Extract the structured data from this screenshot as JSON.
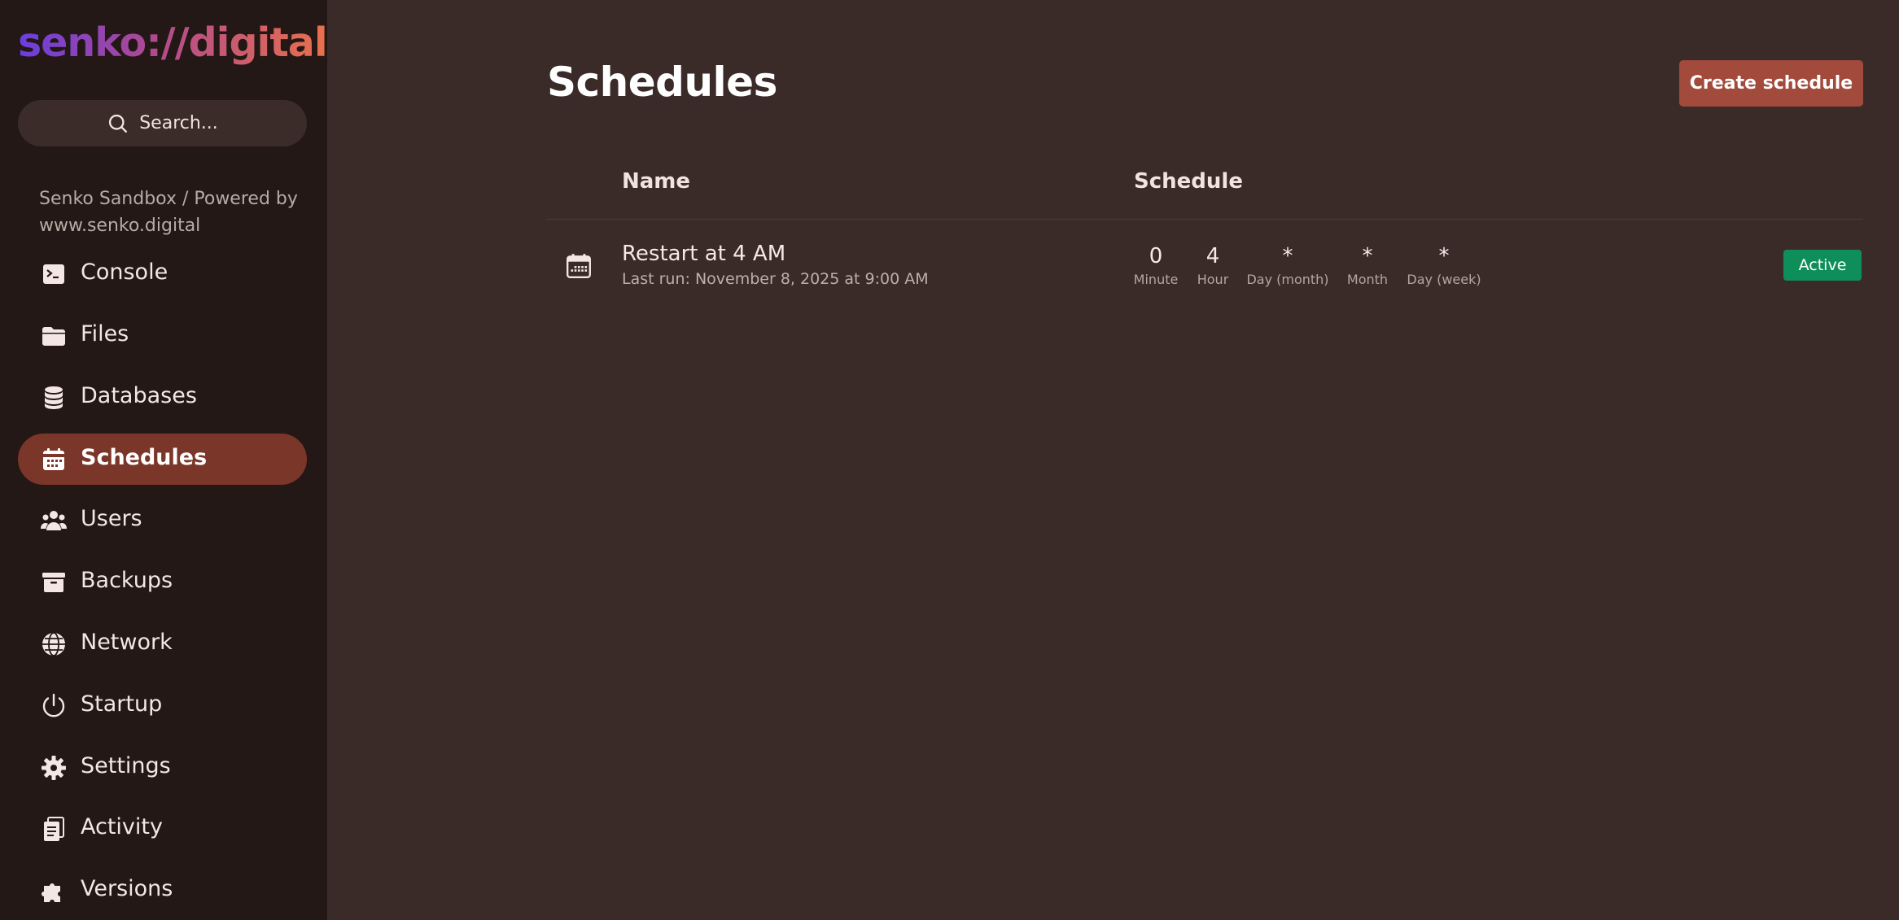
{
  "brand": {
    "logo": "senko://digital"
  },
  "search": {
    "placeholder": "Search..."
  },
  "server": {
    "subtitle": "Senko Sandbox / Powered by www.senko.digital"
  },
  "nav": {
    "items": [
      {
        "label": "Console",
        "icon": "terminal-icon"
      },
      {
        "label": "Files",
        "icon": "folder-icon"
      },
      {
        "label": "Databases",
        "icon": "database-icon"
      },
      {
        "label": "Schedules",
        "icon": "calendar-icon",
        "active": true
      },
      {
        "label": "Users",
        "icon": "users-icon"
      },
      {
        "label": "Backups",
        "icon": "archive-icon"
      },
      {
        "label": "Network",
        "icon": "globe-icon"
      },
      {
        "label": "Startup",
        "icon": "power-icon"
      },
      {
        "label": "Settings",
        "icon": "gear-icon"
      },
      {
        "label": "Activity",
        "icon": "clipboard-icon"
      },
      {
        "label": "Versions",
        "icon": "puzzle-icon"
      }
    ]
  },
  "main": {
    "title": "Schedules",
    "create_label": "Create schedule",
    "columns": {
      "name": "Name",
      "schedule": "Schedule"
    },
    "rows": [
      {
        "name": "Restart at 4 AM",
        "last_run": "Last run: November 8, 2025 at 9:00 AM",
        "cron": [
          {
            "value": "0",
            "label": "Minute"
          },
          {
            "value": "4",
            "label": "Hour"
          },
          {
            "value": "*",
            "label": "Day (month)"
          },
          {
            "value": "*",
            "label": "Month"
          },
          {
            "value": "*",
            "label": "Day (week)"
          }
        ],
        "status": "Active"
      }
    ]
  },
  "colors": {
    "sidebar_bg": "#231815",
    "main_bg": "#3a2b29",
    "active_nav": "#7a3628",
    "primary_button": "#a24a3b",
    "status_active": "#0e8f5a"
  }
}
